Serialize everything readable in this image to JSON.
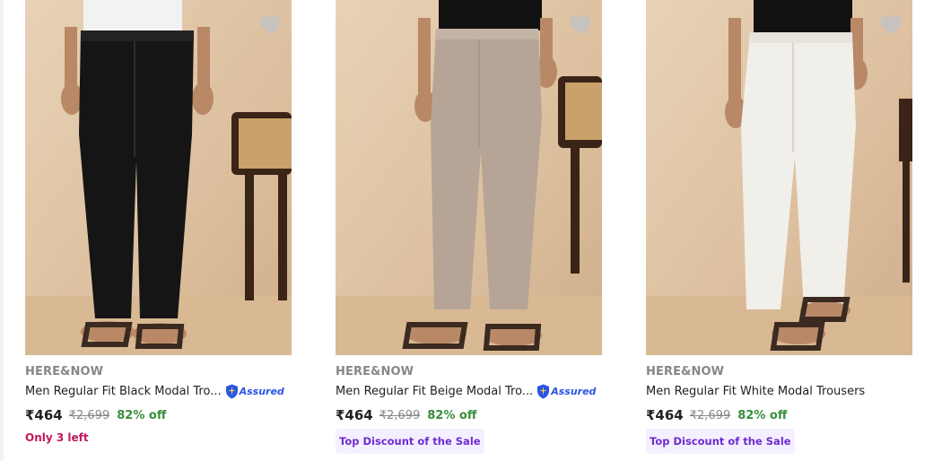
{
  "colors": {
    "price": "#212121",
    "mrp": "#878787",
    "discount": "#388e3c",
    "stock_alert": "#c2185b",
    "badge_text": "#6f2cd3",
    "badge_bg": "#f5f0ff",
    "assured_blue": "#2a55e5"
  },
  "products": [
    {
      "brand": "HERE&NOW",
      "title": "Men Regular Fit Black Modal Tro...",
      "assured": "Assured",
      "price": "₹464",
      "mrp": "₹2,699",
      "discount": "82% off",
      "stock_note": "Only 3 left",
      "pant_color": "#151515",
      "icons": [
        "heart-icon",
        "assured-icon"
      ]
    },
    {
      "brand": "HERE&NOW",
      "title": "Men Regular Fit Beige Modal Tro...",
      "assured": "Assured",
      "price": "₹464",
      "mrp": "₹2,699",
      "discount": "82% off",
      "badge": "Top Discount of the Sale",
      "pant_color": "#b6a596",
      "icons": [
        "heart-icon",
        "assured-icon"
      ]
    },
    {
      "brand": "HERE&NOW",
      "title": "Men Regular Fit White Modal Trousers",
      "price": "₹464",
      "mrp": "₹2,699",
      "discount": "82% off",
      "badge": "Top Discount of the Sale",
      "pant_color": "#f1efea",
      "icons": [
        "heart-icon"
      ]
    }
  ]
}
